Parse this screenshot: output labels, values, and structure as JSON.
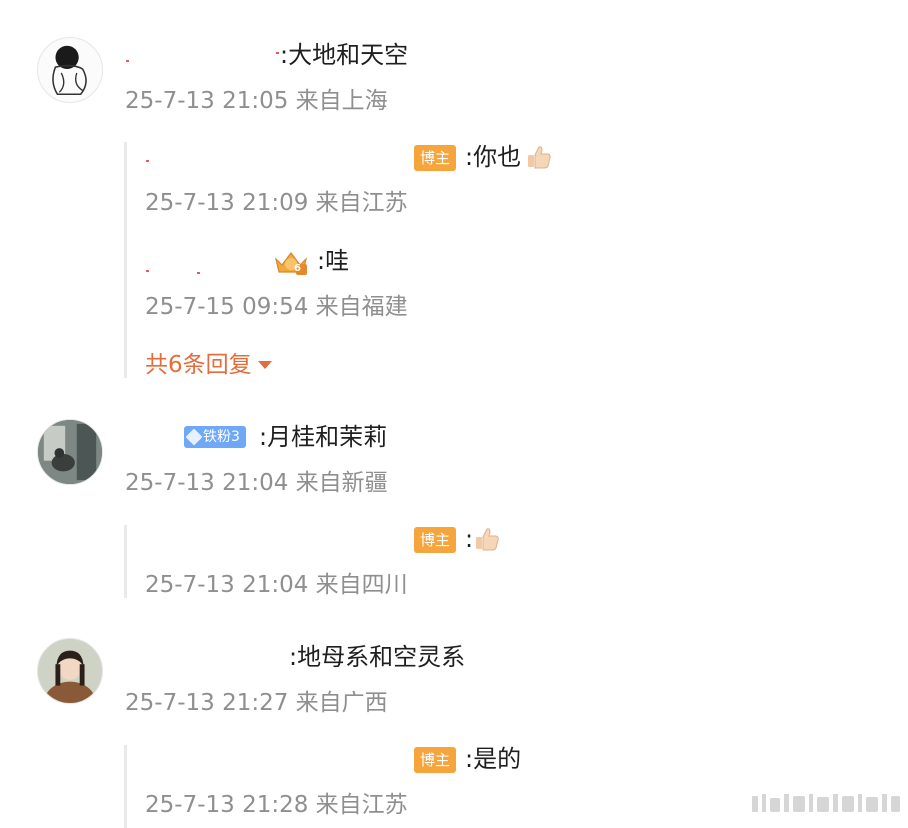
{
  "comments": [
    {
      "text": ":大地和天空",
      "meta": "25-7-13 21:05 来自上海",
      "replies": [
        {
          "badge": "博主",
          "text": ":你也",
          "meta": "25-7-13 21:09 来自江苏",
          "emoji": "thumbs-up"
        },
        {
          "badge_icon": "crown-badge",
          "badge_level": "6",
          "text": ":哇",
          "meta": "25-7-15 09:54 来自福建"
        }
      ],
      "more_replies": "共6条回复"
    },
    {
      "badge": "铁粉3",
      "text": ":月桂和茉莉",
      "meta": "25-7-13 21:04 来自新疆",
      "replies": [
        {
          "badge": "博主",
          "text": ":",
          "meta": "25-7-13 21:04 来自四川",
          "emoji": "thumbs-up"
        }
      ]
    },
    {
      "text": ":地母系和空灵系",
      "meta": "25-7-13 21:27 来自广西",
      "replies": [
        {
          "badge": "博主",
          "text": ":是的",
          "meta": "25-7-13 21:28 来自江苏"
        }
      ]
    }
  ],
  "colors": {
    "text": "#1f1f1f",
    "meta": "#8f8f8f",
    "more_link": "#e26d3d",
    "owner_badge": "#f5a53b",
    "fan_badge": "#6ea8f7",
    "thread_line": "#e9e9e9"
  }
}
